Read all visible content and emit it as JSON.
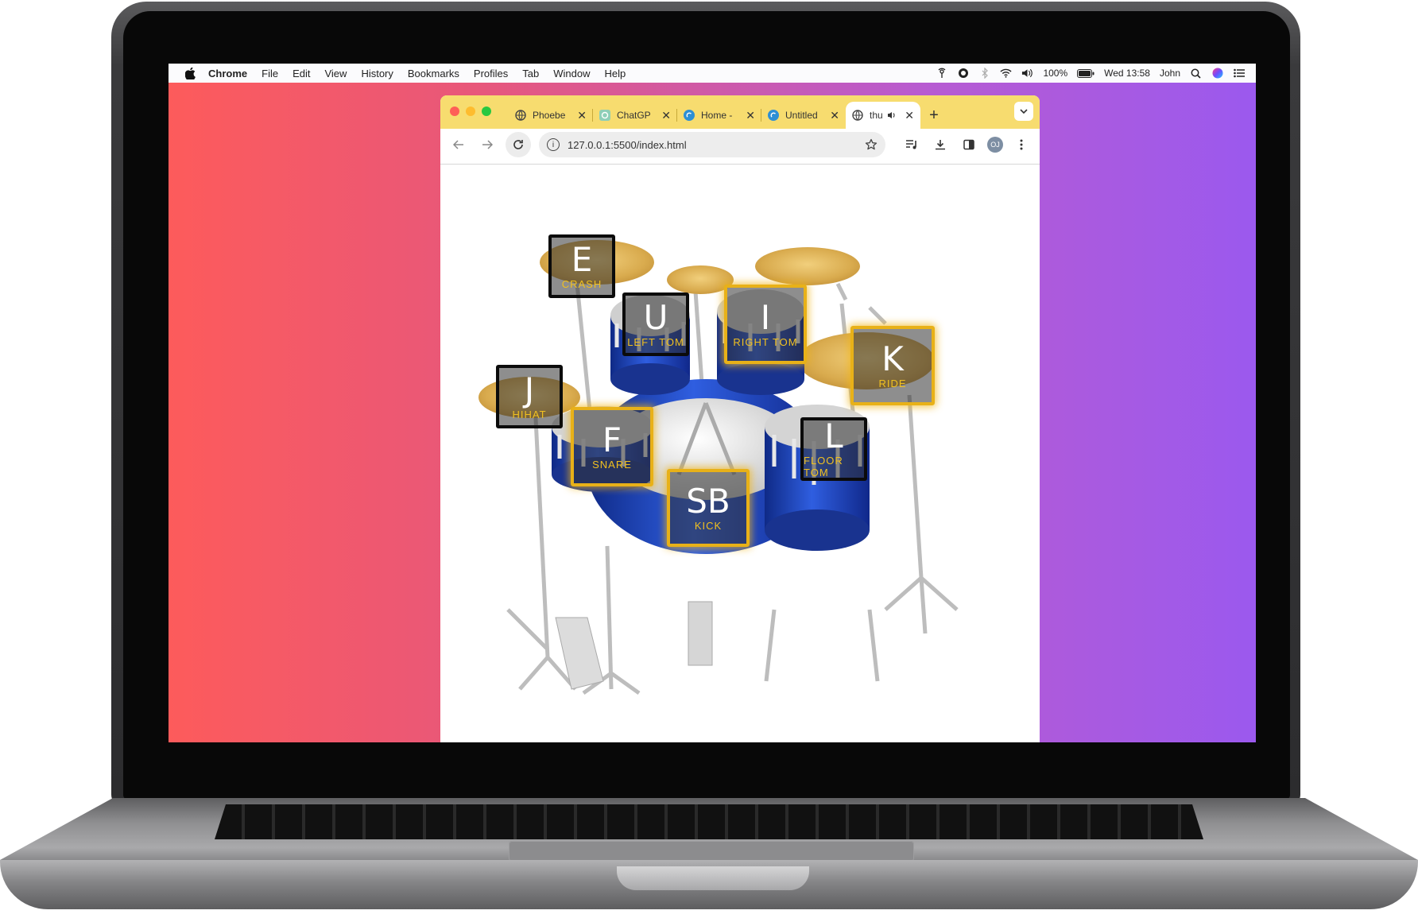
{
  "menubar": {
    "app": "Chrome",
    "items": [
      "File",
      "Edit",
      "View",
      "History",
      "Bookmarks",
      "Profiles",
      "Tab",
      "Window",
      "Help"
    ],
    "battery": "100%",
    "clock": "Wed 13:58",
    "user": "John"
  },
  "browser": {
    "tabs": [
      {
        "label": "Phoebe",
        "icon": "globe-icon"
      },
      {
        "label": "ChatGP",
        "icon": "chatgpt-icon"
      },
      {
        "label": "Home -",
        "icon": "canva-icon"
      },
      {
        "label": "Untitled",
        "icon": "canva-icon"
      },
      {
        "label": "thu",
        "icon": "globe-icon"
      }
    ],
    "url": "127.0.0.1:5500/index.html",
    "avatar": "OJ"
  },
  "pads": [
    {
      "key": "E",
      "label": "CRASH",
      "glow": false
    },
    {
      "key": "U",
      "label": "LEFT TOM",
      "glow": false
    },
    {
      "key": "I",
      "label": "RIGHT TOM",
      "glow": true
    },
    {
      "key": "K",
      "label": "RIDE",
      "glow": true
    },
    {
      "key": "J",
      "label": "HIHAT",
      "glow": false
    },
    {
      "key": "F",
      "label": "SNARE",
      "glow": true
    },
    {
      "key": "L",
      "label": "FLOOR TOM",
      "glow": false
    },
    {
      "key": "SB",
      "label": "KICK",
      "glow": true
    }
  ],
  "colors": {
    "tabstrip": "#f7dc6f",
    "pad_glow": "#e8b118",
    "drum_shell": "#1e3fa8"
  }
}
